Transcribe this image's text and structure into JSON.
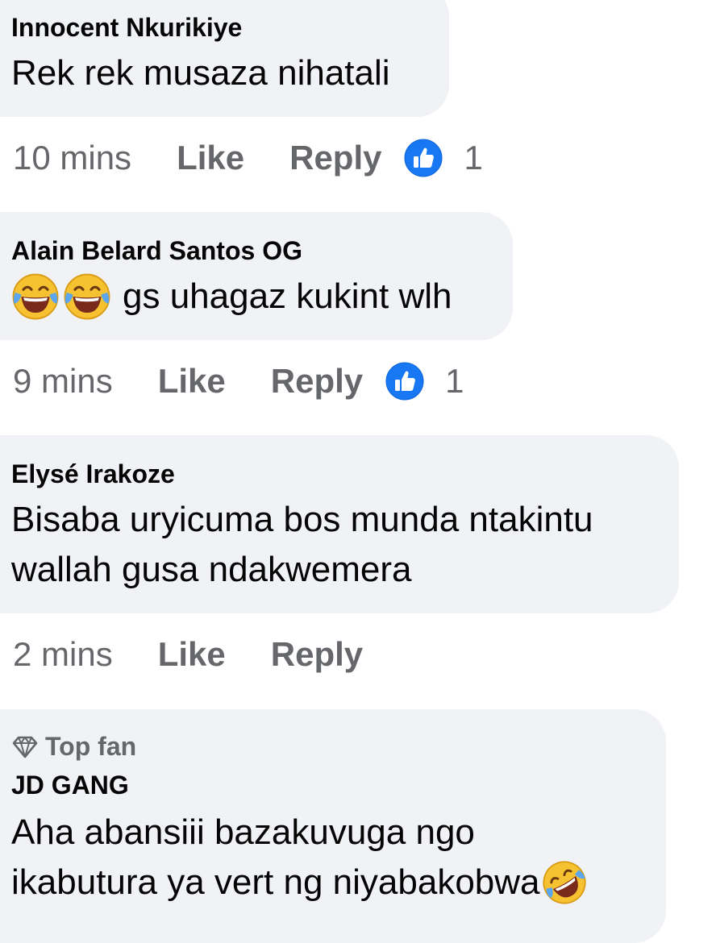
{
  "comments": [
    {
      "author": "Innocent Nkurikiye",
      "text": "Rek rek musaza nihatali",
      "time": "10 mins",
      "like_label": "Like",
      "reply_label": "Reply",
      "reaction_count": "1",
      "reaction_icon": "like-thumb-icon"
    },
    {
      "author": "Alain Belard Santos OG",
      "text": "gs uhagaz kukint wlh",
      "emoji_prefix": [
        "tears-of-joy-emoji",
        "tears-of-joy-emoji"
      ],
      "time": "9 mins",
      "like_label": "Like",
      "reply_label": "Reply",
      "reaction_count": "1",
      "reaction_icon": "like-thumb-icon"
    },
    {
      "author": "Elysé Irakoze",
      "text_line1": "Bisaba uryicuma bos munda ntakintu",
      "text_line2": "wallah gusa ndakwemera",
      "time": "2 mins",
      "like_label": "Like",
      "reply_label": "Reply"
    },
    {
      "badge": "Top fan",
      "badge_icon": "diamond-icon",
      "author": "JD GANG",
      "text_line1": "Aha abansiii bazakuvuga ngo",
      "text_line2": "ikabutura ya vert ng niyabakobwa",
      "emoji_suffix": "rolling-on-floor-laughing-emoji"
    }
  ],
  "colors": {
    "bubble": "#f0f2f5",
    "meta_text": "#65676b",
    "like_blue": "#1877f2",
    "primary_text": "#050505"
  }
}
